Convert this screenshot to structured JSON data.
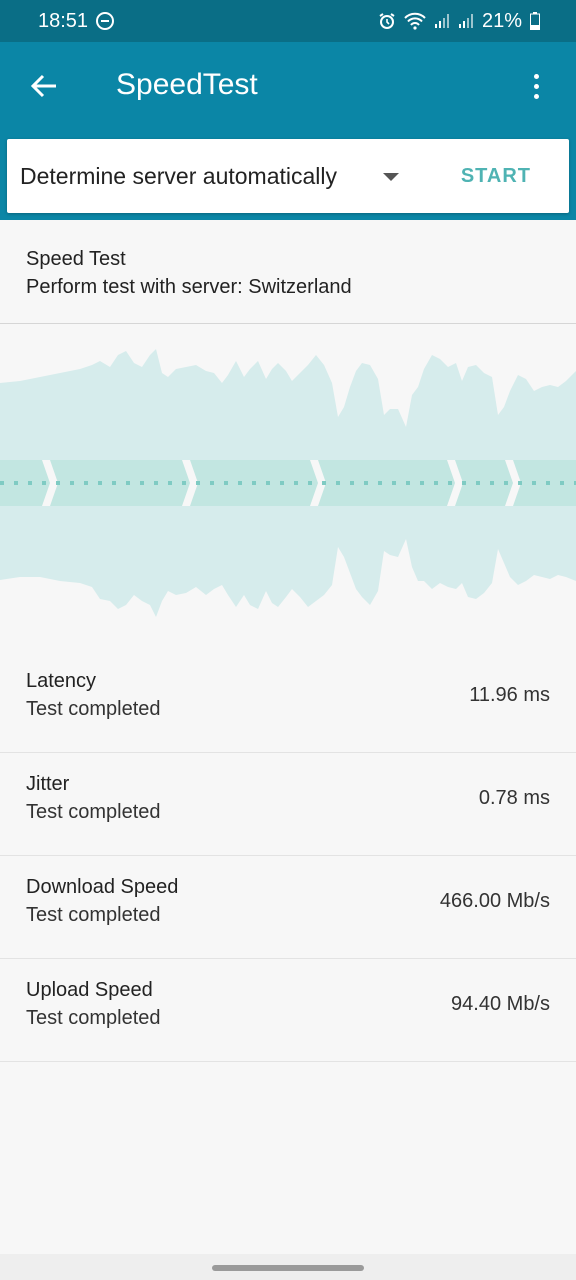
{
  "status_bar": {
    "time": "18:51",
    "battery": "21%",
    "icons": [
      "do-not-disturb-icon",
      "alarm-icon",
      "wifi-icon",
      "cellular-signal-icon",
      "cellular-signal-icon",
      "battery-icon"
    ]
  },
  "app_bar": {
    "title": "SpeedTest",
    "back_icon": "back-arrow-icon",
    "menu_icon": "more-vert-icon"
  },
  "server": {
    "selected": "Determine server automatically",
    "start_label": "START"
  },
  "intro": {
    "title": "Speed Test",
    "subtitle": "Perform test with server: Switzerland"
  },
  "results": [
    {
      "name": "Latency",
      "status": "Test completed",
      "value": "11.96 ms"
    },
    {
      "name": "Jitter",
      "status": "Test completed",
      "value": "0.78 ms"
    },
    {
      "name": "Download Speed",
      "status": "Test completed",
      "value": "466.00 Mb/s"
    },
    {
      "name": "Upload Speed",
      "status": "Test completed",
      "value": "94.40 Mb/s"
    }
  ],
  "colors": {
    "status_bar": "#0a6e86",
    "app_bar": "#0b86a6",
    "accent": "#4fb3b3",
    "wave_fill": "#d6ecec",
    "wave_band": "#bfe3df"
  }
}
